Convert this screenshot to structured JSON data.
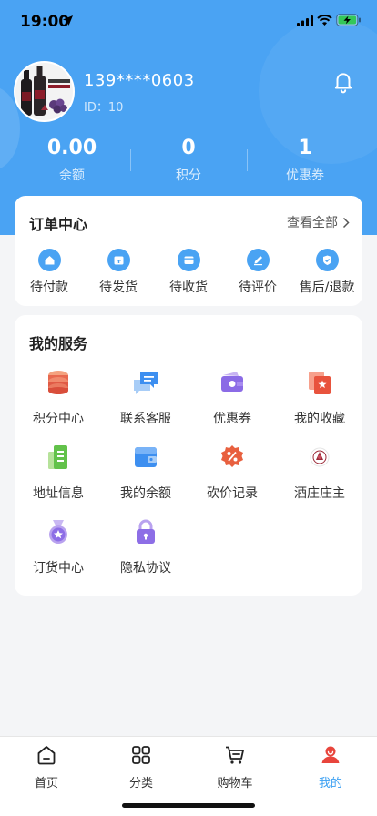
{
  "status_bar": {
    "time": "19:00"
  },
  "profile": {
    "phone": "139****0603",
    "user_id": "ID：10"
  },
  "stats": [
    {
      "value": "0.00",
      "label": "余额"
    },
    {
      "value": "0",
      "label": "积分"
    },
    {
      "value": "1",
      "label": "优惠券"
    }
  ],
  "orders": {
    "title": "订单中心",
    "see_all": "查看全部",
    "items": [
      {
        "label": "待付款",
        "icon": "house-icon"
      },
      {
        "label": "待发货",
        "icon": "calendar-box-icon"
      },
      {
        "label": "待收货",
        "icon": "wallet-icon"
      },
      {
        "label": "待评价",
        "icon": "pencil-icon"
      },
      {
        "label": "售后/退款",
        "icon": "shield-check-icon"
      }
    ]
  },
  "services": {
    "title": "我的服务",
    "items": [
      {
        "label": "积分中心",
        "icon": "coin-stack-icon"
      },
      {
        "label": "联系客服",
        "icon": "chat-bubbles-icon"
      },
      {
        "label": "优惠券",
        "icon": "coupon-icon"
      },
      {
        "label": "我的收藏",
        "icon": "star-cards-icon"
      },
      {
        "label": "地址信息",
        "icon": "address-book-icon"
      },
      {
        "label": "我的余额",
        "icon": "balance-card-icon"
      },
      {
        "label": "砍价记录",
        "icon": "discount-badge-icon"
      },
      {
        "label": "酒庄庄主",
        "icon": "winery-logo-icon"
      },
      {
        "label": "订货中心",
        "icon": "medal-icon"
      },
      {
        "label": "隐私协议",
        "icon": "lock-icon"
      }
    ]
  },
  "tabbar": {
    "items": [
      {
        "label": "首页",
        "icon": "home-icon"
      },
      {
        "label": "分类",
        "icon": "grid-icon"
      },
      {
        "label": "购物车",
        "icon": "cart-icon"
      },
      {
        "label": "我的",
        "icon": "profile-icon",
        "active": true
      }
    ]
  },
  "colors": {
    "primary": "#4aa3f3",
    "active_tab": "#3ba0f2",
    "background": "#f4f5f7"
  }
}
